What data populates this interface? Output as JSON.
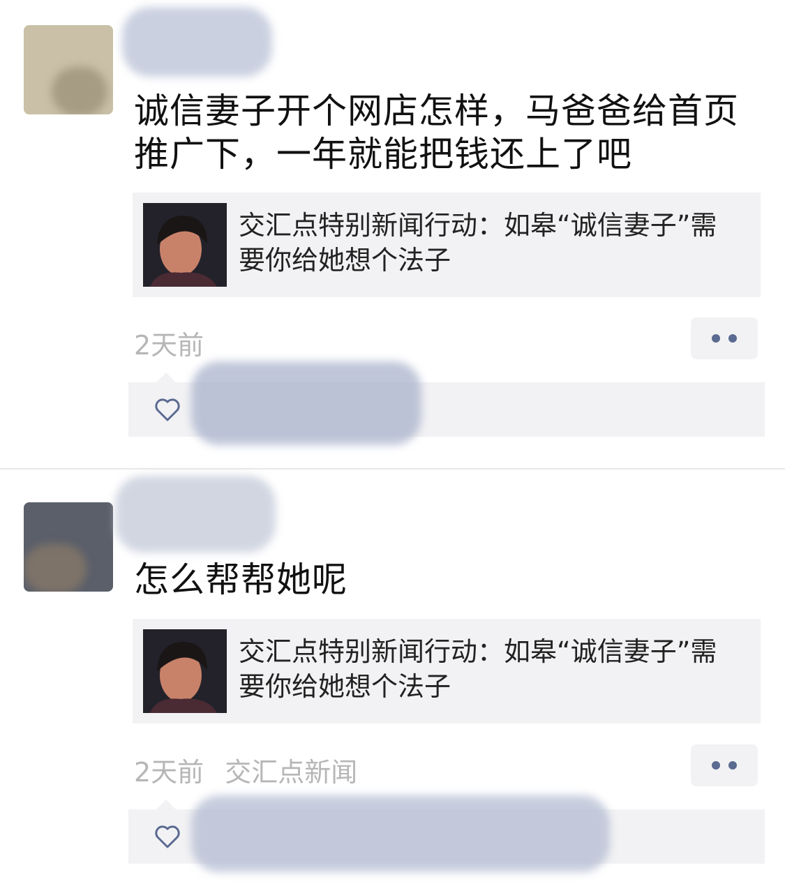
{
  "posts": [
    {
      "text": "诚信妻子开个网店怎样，马爸爸给首页推广下，一年就能把钱还上了吧",
      "link_title": "交汇点特别新闻行动：如皋“诚信妻子”需要你给她想个法子",
      "time": "2天前",
      "source": ""
    },
    {
      "text": "怎么帮帮她呢",
      "link_title": "交汇点特别新闻行动：如皋“诚信妻子”需要你给她想个法子",
      "time": "2天前",
      "source": "交汇点新闻"
    }
  ],
  "colors": {
    "accent": "#5b6a91",
    "card_bg": "#f2f2f4",
    "meta_text": "#b6b6b6"
  },
  "icons": {
    "more": "more-dots-icon",
    "like": "heart-icon"
  }
}
